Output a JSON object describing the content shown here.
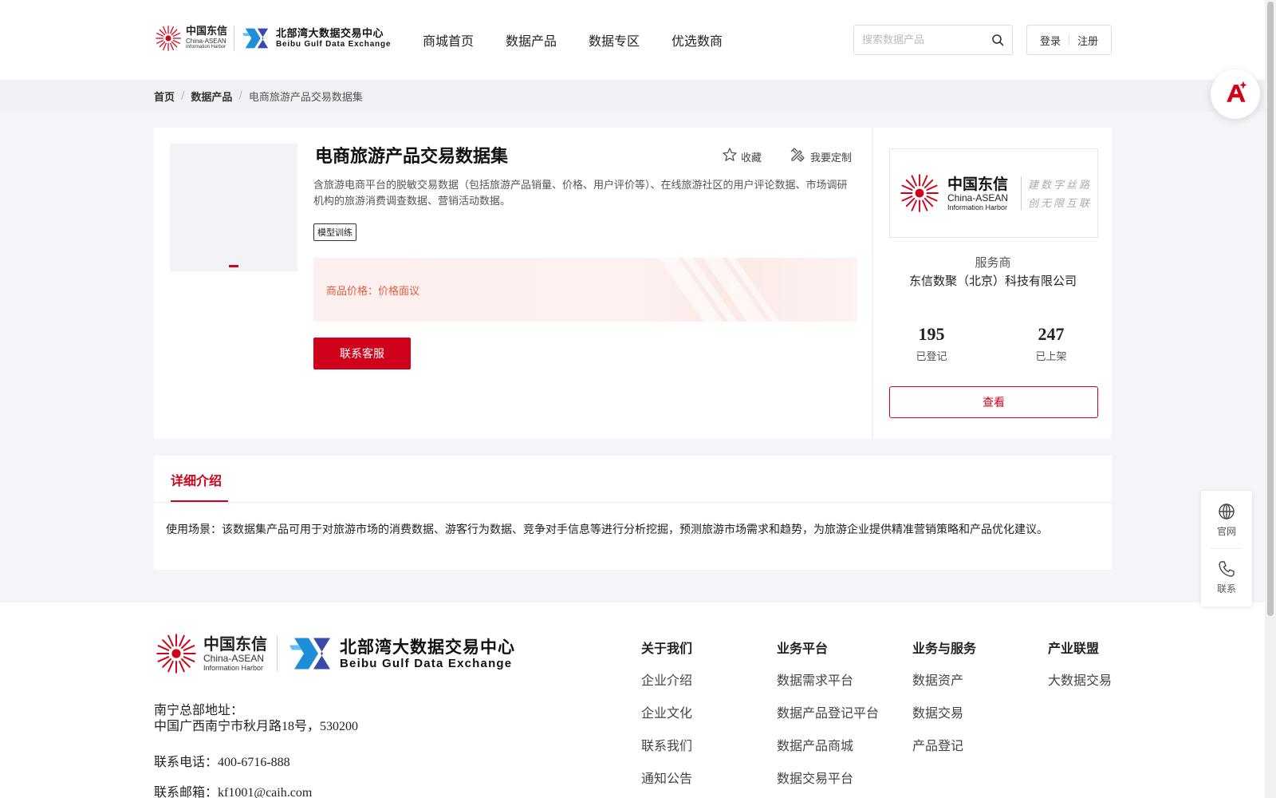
{
  "header": {
    "logo": {
      "cn": "中国东信",
      "en1": "China-ASEAN",
      "en2": "Information Harbor",
      "exchange_cn": "北部湾大数据交易中心",
      "exchange_en": "Beibu Gulf Data Exchange"
    },
    "nav": [
      "商城首页",
      "数据产品",
      "数据专区",
      "优选数商"
    ],
    "search": {
      "placeholder": "搜索数据产品"
    },
    "login": "登录",
    "register": "注册"
  },
  "breadcrumb": {
    "home": "首页",
    "category": "数据产品",
    "current": "电商旅游产品交易数据集",
    "separator": "/"
  },
  "product": {
    "title": "电商旅游产品交易数据集",
    "favorite_label": "收藏",
    "custom_label": "我要定制",
    "description": "含旅游电商平台的脱敏交易数据（包括旅游产品销量、价格、用户评价等）、在线旅游社区的用户评论数据、市场调研机构的旅游消费调查数据、营销活动数据。",
    "tag": "模型训练",
    "price_label": "商品价格：",
    "price_value": "价格面议",
    "contact_button": "联系客服"
  },
  "vendor": {
    "logo_cn": "中国东信",
    "logo_en1": "China-ASEAN",
    "logo_en2": "Information Harbor",
    "slogan1": "建数字丝路",
    "slogan2": "创无限互联",
    "role": "服务商",
    "name": "东信数聚（北京）科技有限公司",
    "stats": [
      {
        "value": "195",
        "label": "已登记"
      },
      {
        "value": "247",
        "label": "已上架"
      }
    ],
    "view_button": "查看"
  },
  "detail": {
    "tab": "详细介绍",
    "text": "使用场景：该数据集产品可用于对旅游市场的消费数据、游客行为数据、竞争对手信息等进行分析挖掘，预测旅游市场需求和趋势，为旅游企业提供精准营销策略和产品优化建议。"
  },
  "footer": {
    "address_label": "南宁总部地址：",
    "address": "中国广西南宁市秋月路18号，530200",
    "phone": "联系电话：400-6716-888",
    "email": "联系邮箱：kf1001@caih.com",
    "columns": [
      {
        "title": "关于我们",
        "items": [
          "企业介绍",
          "企业文化",
          "联系我们",
          "通知公告"
        ]
      },
      {
        "title": "业务平台",
        "items": [
          "数据需求平台",
          "数据产品登记平台",
          "数据产品商城",
          "数据交易平台"
        ]
      },
      {
        "title": "业务与服务",
        "items": [
          "数据资产",
          "数据交易",
          "产品登记"
        ]
      },
      {
        "title": "产业联盟",
        "items": [
          "大数据交易"
        ]
      }
    ]
  },
  "side_panel": {
    "website": "官网",
    "contact": "联系"
  },
  "colors": {
    "brand_red": "#d0021b",
    "price_orange": "#e05a3c",
    "page_bg": "#f4f5f8"
  }
}
